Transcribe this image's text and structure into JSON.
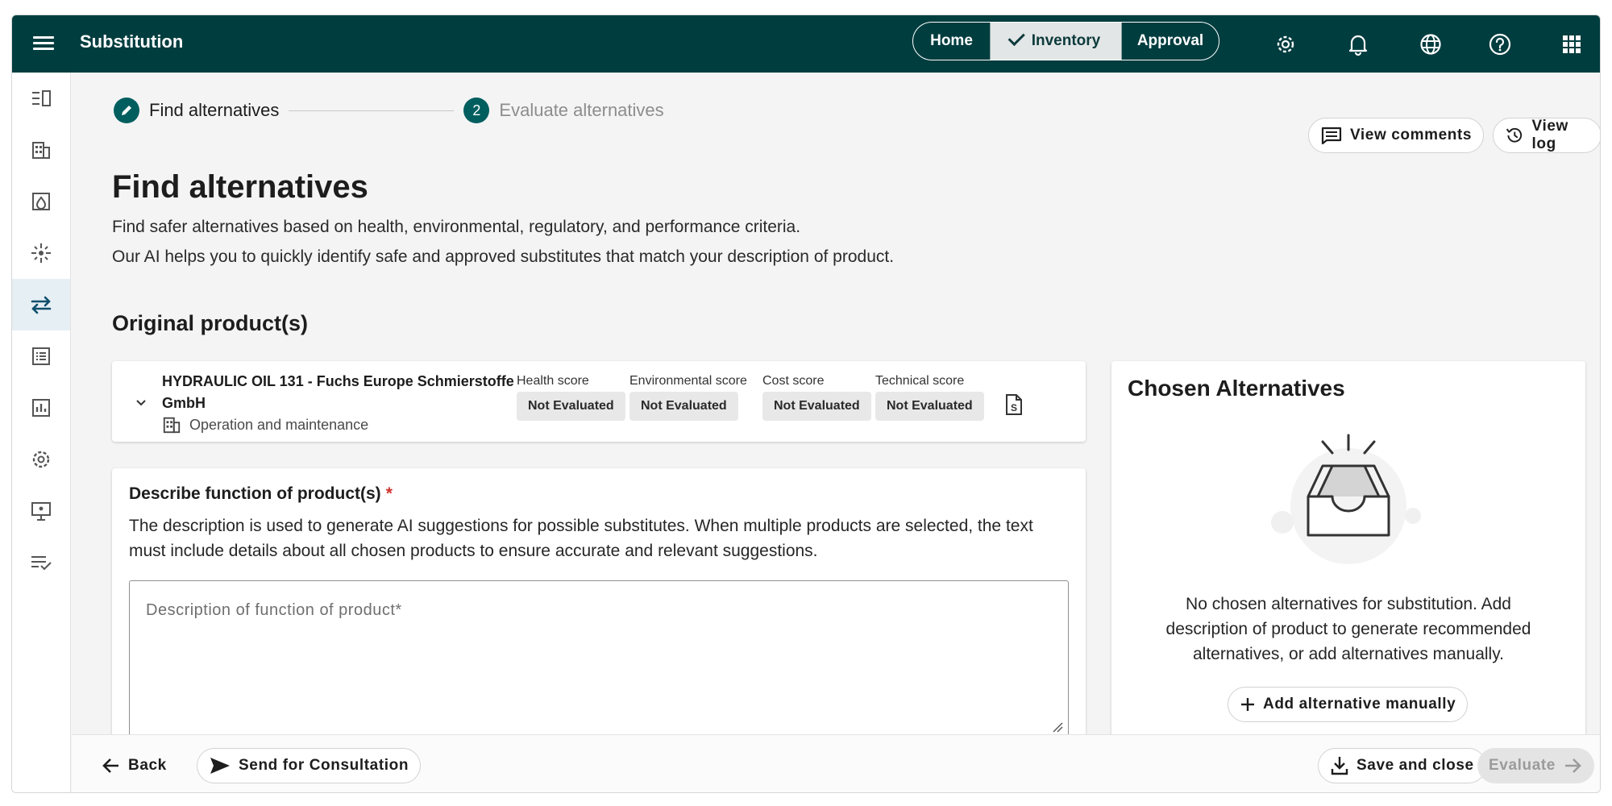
{
  "app": {
    "title": "Substitution"
  },
  "nav": {
    "home": "Home",
    "inventory": "Inventory",
    "approval": "Approval"
  },
  "stepper": {
    "step1": {
      "label": "Find alternatives",
      "icon": "pencil-icon"
    },
    "step2": {
      "number": "2",
      "label": "Evaluate alternatives"
    }
  },
  "actions": {
    "view_comments": "View comments",
    "view_log": "View log"
  },
  "page": {
    "title": "Find alternatives",
    "subtitle_1": "Find safer alternatives based on health, environmental, regulatory, and performance criteria.",
    "subtitle_2": "Our AI helps you to quickly identify safe and approved substitutes that match your description of product."
  },
  "original": {
    "section_title": "Original product(s)",
    "product": {
      "name": "HYDRAULIC OIL 131 - Fuchs Europe Schmierstoffe GmbH",
      "category": "Operation and maintenance",
      "scores": [
        {
          "label": "Health score",
          "value": "Not Evaluated"
        },
        {
          "label": "Environmental score",
          "value": "Not Evaluated"
        },
        {
          "label": "Cost score",
          "value": "Not Evaluated"
        },
        {
          "label": "Technical score",
          "value": "Not Evaluated"
        }
      ]
    }
  },
  "describe": {
    "title": "Describe function of product(s)",
    "required_mark": "*",
    "help": "The description is used to generate AI suggestions for possible substitutes. When multiple products are selected, the text must include details about all chosen products to ensure accurate and relevant suggestions.",
    "placeholder": "Description of function of product*",
    "value": ""
  },
  "chosen": {
    "title": "Chosen Alternatives",
    "empty_message": "No chosen alternatives for substitution. Add description of product to generate recommended alternatives, or add alternatives manually.",
    "add_button": "Add alternative manually"
  },
  "footer": {
    "back": "Back",
    "send": "Send for Consultation",
    "save": "Save and close",
    "evaluate": "Evaluate"
  },
  "colors": {
    "header_bg": "#003d3f",
    "accent": "#005e5f",
    "required": "#d0312d",
    "active_sidebar": "#e6eff4"
  }
}
